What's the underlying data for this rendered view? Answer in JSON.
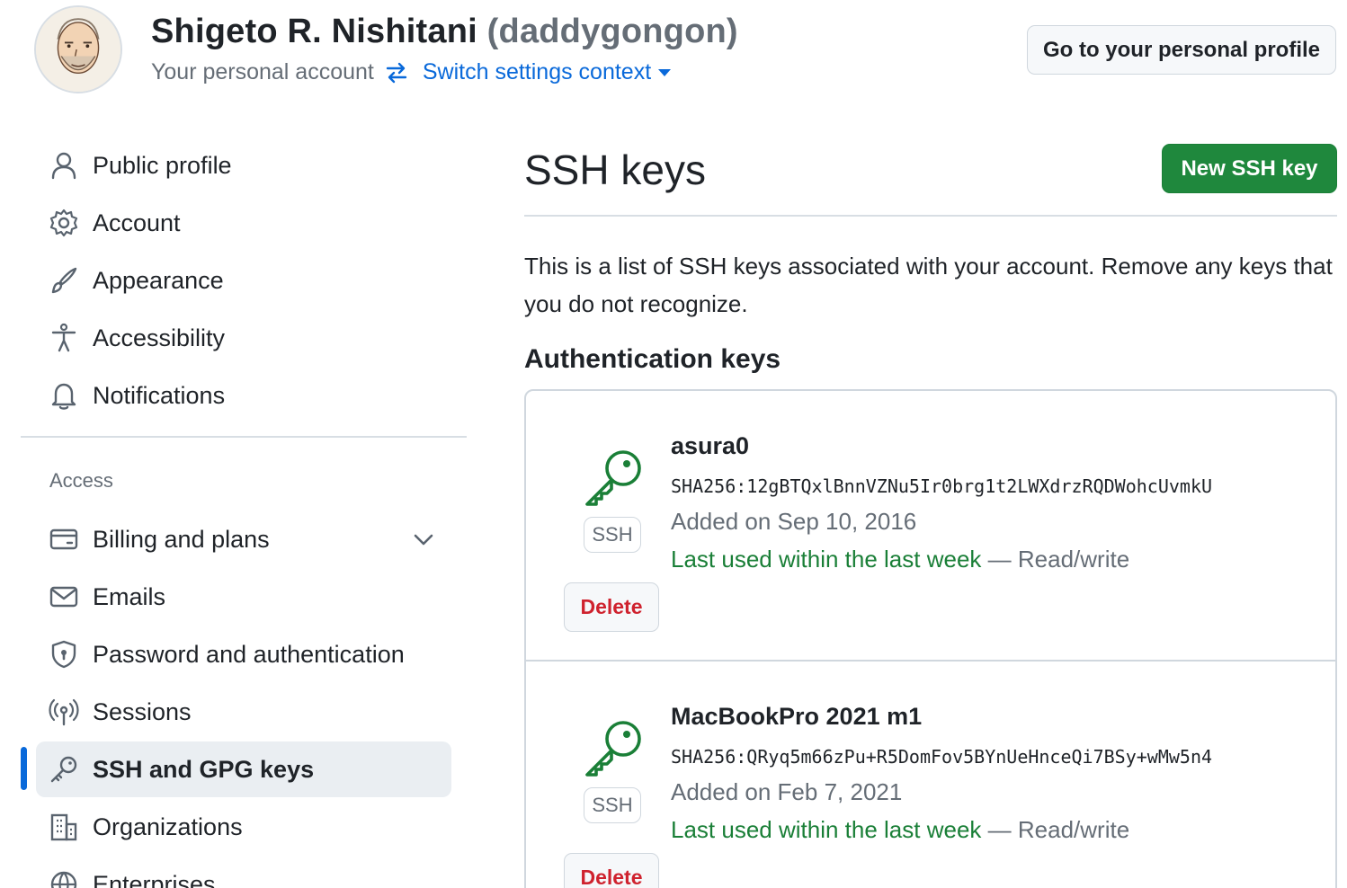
{
  "header": {
    "display_name": "Shigeto R. Nishitani",
    "login": "(daddygongon)",
    "account_type": "Your personal account",
    "switch_label": "Switch settings context",
    "profile_button": "Go to your personal profile"
  },
  "sidebar": {
    "items_top": [
      {
        "label": "Public profile",
        "icon": "person-icon"
      },
      {
        "label": "Account",
        "icon": "gear-icon"
      },
      {
        "label": "Appearance",
        "icon": "paintbrush-icon"
      },
      {
        "label": "Accessibility",
        "icon": "accessibility-icon"
      },
      {
        "label": "Notifications",
        "icon": "bell-icon"
      }
    ],
    "access_heading": "Access",
    "items_access": [
      {
        "label": "Billing and plans",
        "icon": "credit-card-icon",
        "expandable": true
      },
      {
        "label": "Emails",
        "icon": "mail-icon"
      },
      {
        "label": "Password and authentication",
        "icon": "shield-lock-icon"
      },
      {
        "label": "Sessions",
        "icon": "broadcast-icon"
      },
      {
        "label": "SSH and GPG keys",
        "icon": "key-icon",
        "active": true
      },
      {
        "label": "Organizations",
        "icon": "organization-icon"
      },
      {
        "label": "Enterprises",
        "icon": "globe-icon"
      }
    ]
  },
  "main": {
    "title": "SSH keys",
    "new_button": "New SSH key",
    "intro": "This is a list of SSH keys associated with your account. Remove any keys that you do not recognize.",
    "section_title": "Authentication keys",
    "keys": [
      {
        "title": "asura0",
        "fingerprint": "SHA256:12gBTQxlBnnVZNu5Ir0brg1t2LWXdrzRQDWohcUvmkU",
        "added": "Added on Sep 10, 2016",
        "last_used": "Last used within the last week",
        "access": "— Read/write",
        "badge": "SSH",
        "delete": "Delete"
      },
      {
        "title": "MacBookPro 2021 m1",
        "fingerprint": "SHA256:QRyq5m66zPu+R5DomFov5BYnUeHnceQi7BSy+wMw5n4",
        "added": "Added on Feb 7, 2021",
        "last_used": "Last used within the last week",
        "access": "— Read/write",
        "badge": "SSH",
        "delete": "Delete"
      }
    ]
  },
  "colors": {
    "link_blue": "#0969da",
    "primary_green": "#1f883d",
    "last_used_green": "#1a7f37",
    "danger_red": "#cf222e",
    "muted": "#656d76"
  }
}
